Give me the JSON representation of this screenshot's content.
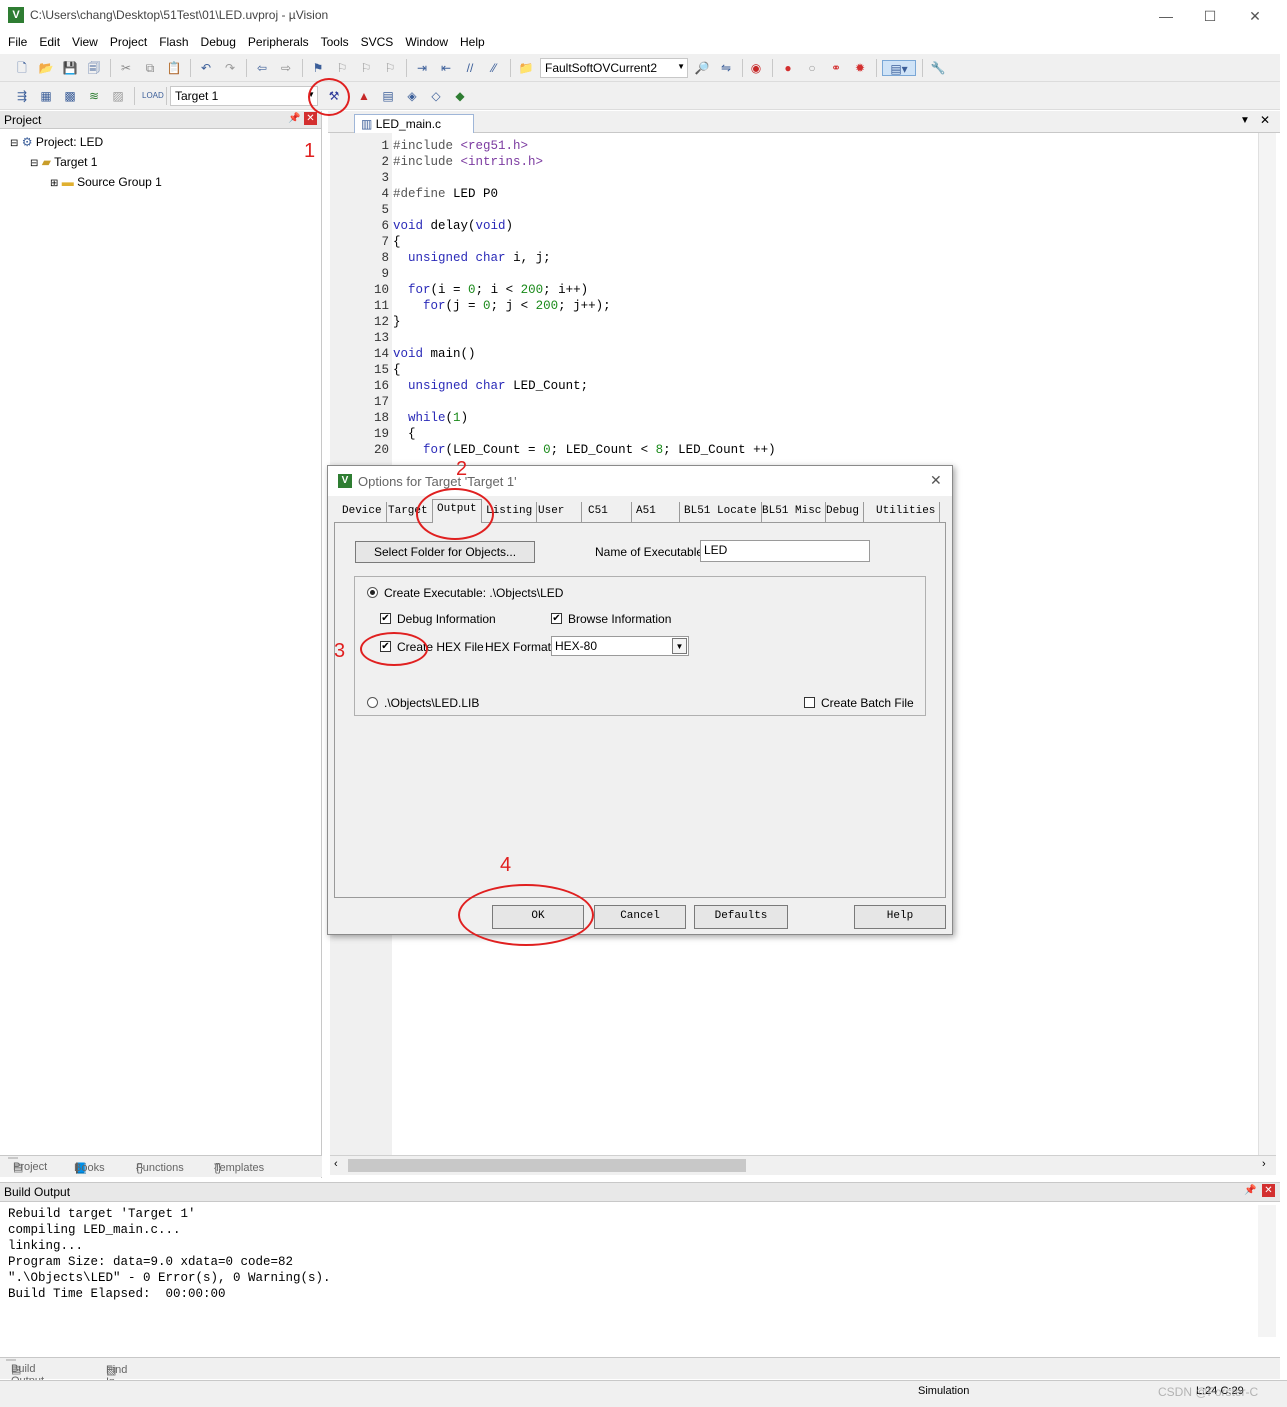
{
  "window": {
    "title": "C:\\Users\\chang\\Desktop\\51Test\\01\\LED.uvproj - µVision",
    "app_icon": "µVision-icon",
    "controls": {
      "minimize": "—",
      "maximize": "☐",
      "close": "✕"
    }
  },
  "menu": [
    "File",
    "Edit",
    "View",
    "Project",
    "Flash",
    "Debug",
    "Peripherals",
    "Tools",
    "SVCS",
    "Window",
    "Help"
  ],
  "toolbar1": {
    "search_value": "FaultSoftOVCurrent2"
  },
  "toolbar2": {
    "target_value": "Target 1"
  },
  "project_panel": {
    "title": "Project",
    "pin": "📌",
    "close": "✕",
    "tree": {
      "root": "Project: LED",
      "target": "Target 1",
      "group": "Source Group 1"
    },
    "tabs": [
      "Project",
      "Books",
      "Functions",
      "Templates"
    ]
  },
  "editor": {
    "tab_label": "LED_main.c",
    "lines": [
      {
        "n": "1",
        "text": "#include <reg51.h>"
      },
      {
        "n": "2",
        "text": "#include <intrins.h>"
      },
      {
        "n": "3",
        "text": ""
      },
      {
        "n": "4",
        "text": "#define LED P0"
      },
      {
        "n": "5",
        "text": ""
      },
      {
        "n": "6",
        "text": "void delay(void)"
      },
      {
        "n": "7",
        "text": "{"
      },
      {
        "n": "8",
        "text": "  unsigned char i, j;"
      },
      {
        "n": "9",
        "text": ""
      },
      {
        "n": "10",
        "text": "  for(i = 0; i < 200; i++)"
      },
      {
        "n": "11",
        "text": "    for(j = 0; j < 200; j++);"
      },
      {
        "n": "12",
        "text": "}"
      },
      {
        "n": "13",
        "text": ""
      },
      {
        "n": "14",
        "text": "void main()"
      },
      {
        "n": "15",
        "text": "{"
      },
      {
        "n": "16",
        "text": "  unsigned char LED_Count;"
      },
      {
        "n": "17",
        "text": ""
      },
      {
        "n": "18",
        "text": "  while(1)"
      },
      {
        "n": "19",
        "text": "  {"
      },
      {
        "n": "20",
        "text": "    for(LED_Count = 0; LED_Count < 8; LED_Count ++)"
      }
    ]
  },
  "dialog": {
    "title": "Options for Target 'Target 1'",
    "tabs": [
      "Device",
      "Target",
      "Output",
      "Listing",
      "User",
      "C51",
      "A51",
      "BL51 Locate",
      "BL51 Misc",
      "Debug",
      "Utilities"
    ],
    "select_folder_btn": "Select Folder for Objects...",
    "name_exe_label": "Name of Executable:",
    "name_exe_value": "LED",
    "create_exe_label": "Create Executable:  .\\Objects\\LED",
    "debug_info_label": "Debug Information",
    "browse_info_label": "Browse Information",
    "create_hex_label": "Create HEX File",
    "hex_format_label": "HEX Format:",
    "hex_format_value": "HEX-80",
    "lib_label": ".\\Objects\\LED.LIB",
    "batch_label": "Create Batch File",
    "ok": "OK",
    "cancel": "Cancel",
    "defaults": "Defaults",
    "help": "Help"
  },
  "build_output": {
    "title": "Build Output",
    "lines": [
      "Rebuild target 'Target 1'",
      "compiling LED_main.c...",
      "linking...",
      "Program Size: data=9.0 xdata=0 code=82",
      "\".\\Objects\\LED\" - 0 Error(s), 0 Warning(s).",
      "Build Time Elapsed:  00:00:00"
    ],
    "tabs": [
      "Build Output",
      "Find In Files"
    ]
  },
  "status": {
    "mode": "Simulation",
    "pos": "L:24 C:29",
    "watermark": "CSDN @Forster-C"
  },
  "annotations": [
    "1",
    "2",
    "3",
    "4"
  ],
  "colors": {
    "annotation": "#e02020",
    "keyword": "#2a2ab8",
    "number": "#1a8a1a"
  }
}
